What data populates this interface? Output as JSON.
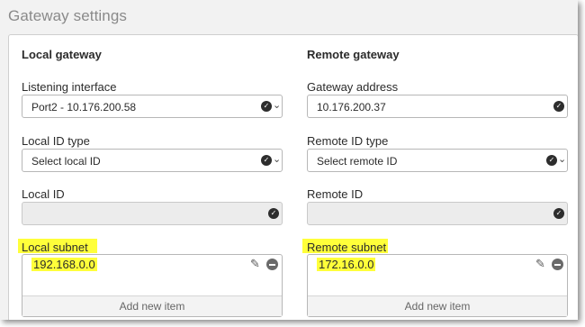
{
  "section": {
    "title": "Gateway settings"
  },
  "local": {
    "title": "Local gateway",
    "listening_interface": {
      "label": "Listening interface",
      "value": "Port2 - 10.176.200.58"
    },
    "local_id_type": {
      "label": "Local ID type",
      "value": "Select local ID"
    },
    "local_id": {
      "label": "Local ID",
      "value": ""
    },
    "local_subnet": {
      "label": "Local subnet",
      "items": [
        "192.168.0.0"
      ],
      "add_label": "Add new item"
    }
  },
  "remote": {
    "title": "Remote gateway",
    "gateway_address": {
      "label": "Gateway address",
      "value": "10.176.200.37"
    },
    "remote_id_type": {
      "label": "Remote ID type",
      "value": "Select remote ID"
    },
    "remote_id": {
      "label": "Remote ID",
      "value": ""
    },
    "remote_subnet": {
      "label": "Remote subnet",
      "items": [
        "172.16.0.0"
      ],
      "add_label": "Add new item"
    }
  },
  "colors": {
    "highlight": "#ffff3a",
    "check": "#2d2d2d"
  },
  "icons": {
    "check": "check-circle-icon",
    "caret": "chevron-down-icon",
    "edit": "pencil-icon",
    "remove": "minus-circle-icon"
  }
}
